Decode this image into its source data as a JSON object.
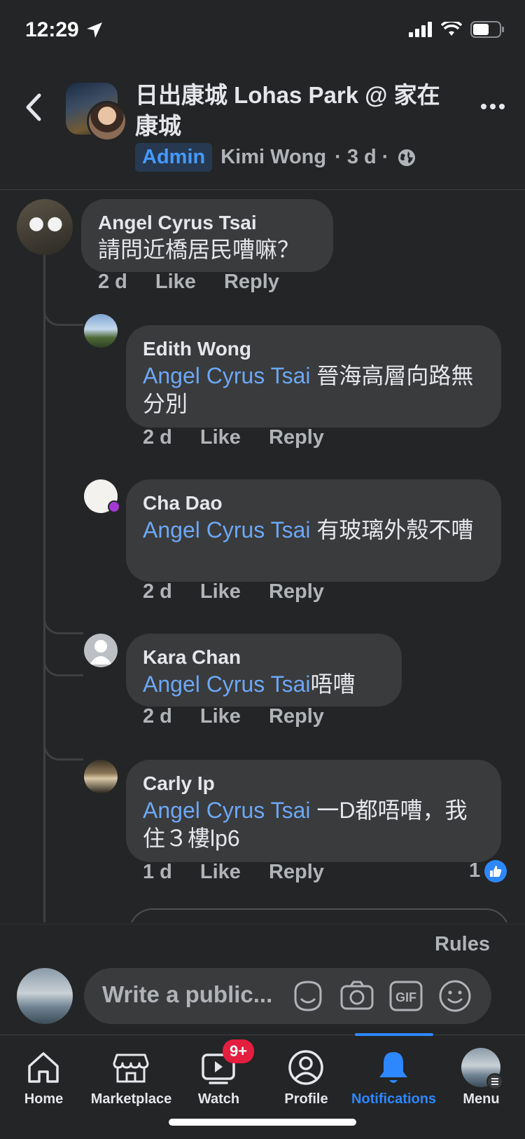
{
  "status_bar": {
    "time": "12:29"
  },
  "header": {
    "group_title": "日出康城 Lohas Park @ 家在康城",
    "admin_badge": "Admin",
    "author": "Kimi Wong",
    "post_age": "· 3 d ·",
    "icons": [
      "back-icon",
      "more-icon",
      "globe-icon"
    ]
  },
  "comments": [
    {
      "name": "Angel Cyrus Tsai",
      "mention": "",
      "text": "請問近橋居民嘈嘛？",
      "time": "2 d",
      "like": "Like",
      "reply": "Reply"
    },
    {
      "name": "Edith Wong",
      "mention": "Angel Cyrus Tsai",
      "text": " 晉海高層向路無分別",
      "time": "2 d",
      "like": "Like",
      "reply": "Reply"
    },
    {
      "name": "Cha Dao",
      "mention": "Angel Cyrus Tsai",
      "text": " 有玻璃外殼不嘈",
      "time": "2 d",
      "like": "Like",
      "reply": "Reply"
    },
    {
      "name": "Kara Chan",
      "mention": "Angel Cyrus Tsai",
      "text": "唔嘈",
      "time": "2 d",
      "like": "Like",
      "reply": "Reply"
    },
    {
      "name": "Carly Ip",
      "mention": "Angel Cyrus Tsai",
      "text": " 一D都唔嘈，我住３樓lp6",
      "time": "1 d",
      "like": "Like",
      "reply": "Reply",
      "reaction_count": "1"
    }
  ],
  "composer": {
    "rules": "Rules",
    "placeholder": "Write a public...",
    "tools": [
      "sticker-icon",
      "camera-icon",
      "gif-icon",
      "emoji-icon"
    ],
    "gif_label": "GIF"
  },
  "tabs": [
    {
      "label": "Home",
      "icon": "home-icon"
    },
    {
      "label": "Marketplace",
      "icon": "marketplace-icon"
    },
    {
      "label": "Watch",
      "icon": "watch-icon",
      "badge": "9+"
    },
    {
      "label": "Profile",
      "icon": "profile-icon"
    },
    {
      "label": "Notifications",
      "icon": "bell-icon",
      "active": true
    },
    {
      "label": "Menu",
      "icon": "menu-avatar"
    }
  ],
  "colors": {
    "background": "#242526",
    "bubble": "#3a3b3c",
    "mention": "#6ca7f5",
    "accent": "#2d88ff",
    "badge": "#e41e3f"
  }
}
